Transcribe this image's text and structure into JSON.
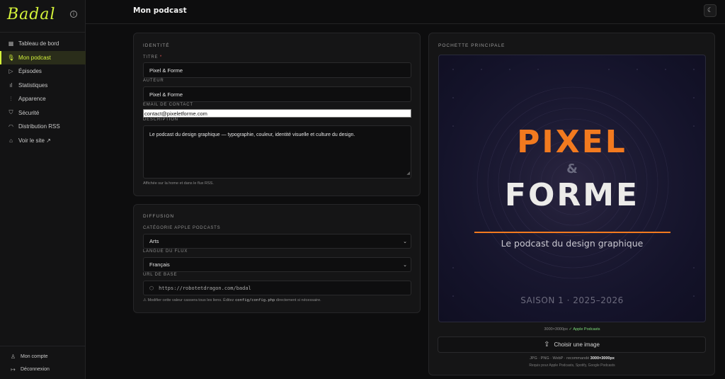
{
  "app": {
    "logo_text": "Badal",
    "info_icon": "info-icon"
  },
  "sidebar": {
    "items": [
      {
        "label": "Tableau de bord",
        "icon": "grid-icon",
        "glyph": "▦",
        "active": false
      },
      {
        "label": "Mon podcast",
        "icon": "microphone-icon",
        "glyph": "🎙",
        "active": true
      },
      {
        "label": "Épisodes",
        "icon": "play-icon",
        "glyph": "▷",
        "active": false
      },
      {
        "label": "Statistiques",
        "icon": "bar-chart-icon",
        "glyph": "ıl",
        "active": false
      },
      {
        "label": "Apparence",
        "icon": "sliders-icon",
        "glyph": "⫶",
        "active": false
      },
      {
        "label": "Sécurité",
        "icon": "shield-icon",
        "glyph": "⛉",
        "active": false
      },
      {
        "label": "Distribution RSS",
        "icon": "rss-icon",
        "glyph": "◠",
        "active": false
      },
      {
        "label": "Voir le site ↗",
        "icon": "home-icon",
        "glyph": "⌂",
        "active": false
      }
    ],
    "bottom": [
      {
        "label": "Mon compte",
        "icon": "user-icon",
        "glyph": "♙"
      },
      {
        "label": "Déconnexion",
        "icon": "logout-icon",
        "glyph": "↦"
      }
    ]
  },
  "header": {
    "title": "Mon podcast",
    "theme_icon": "moon-icon"
  },
  "identite": {
    "section_title": "IDENTITÉ",
    "titre_label": "TITRE",
    "titre_required": "*",
    "titre_value": "Pixel & Forme",
    "auteur_label": "AUTEUR",
    "auteur_value": "Pixel & Forme",
    "email_label": "EMAIL DE CONTACT",
    "email_value": "contact@pixeletforme.com",
    "description_label": "DESCRIPTION",
    "description_value": "Le podcast du design graphique — typographie, couleur, identité visuelle et culture du design.",
    "description_hint": "Affichée sur la home et dans le flux RSS."
  },
  "diffusion": {
    "section_title": "DIFFUSION",
    "categorie_label": "CATÉGORIE APPLE PODCASTS",
    "categorie_value": "Arts",
    "langue_label": "LANGUE DU FLUX",
    "langue_value": "Français",
    "url_label": "URL DE BASE",
    "url_value": "https://robotetdragon.com/badal",
    "url_hint_prefix": "⚠ Modifier cette valeur cassera tous les liens. Éditez ",
    "url_hint_code": "config/config.php",
    "url_hint_suffix": " directement si nécessaire."
  },
  "pochette": {
    "section_title": "POCHETTE PRINCIPALE",
    "cover_line1": "PIXEL",
    "cover_amp": "&",
    "cover_line2": "FORME",
    "cover_subtitle": "Le podcast du design graphique",
    "cover_season": "SAISON 1 · 2025–2026",
    "dimensions": "3000×3000px",
    "dimensions_ok": "✓ Apple Podcasts",
    "upload_label": "Choisir une image",
    "formats_prefix": "JPG · PNG · WebP · recommandé ",
    "formats_bold": "3000×3000px",
    "required_for": "Requis pour Apple Podcasts, Spotify, Google Podcasts",
    "accent_color": "#f27a1f"
  },
  "colors": {
    "brand": "#d4f23a",
    "background": "#0d0d0e",
    "card": "#151516"
  }
}
